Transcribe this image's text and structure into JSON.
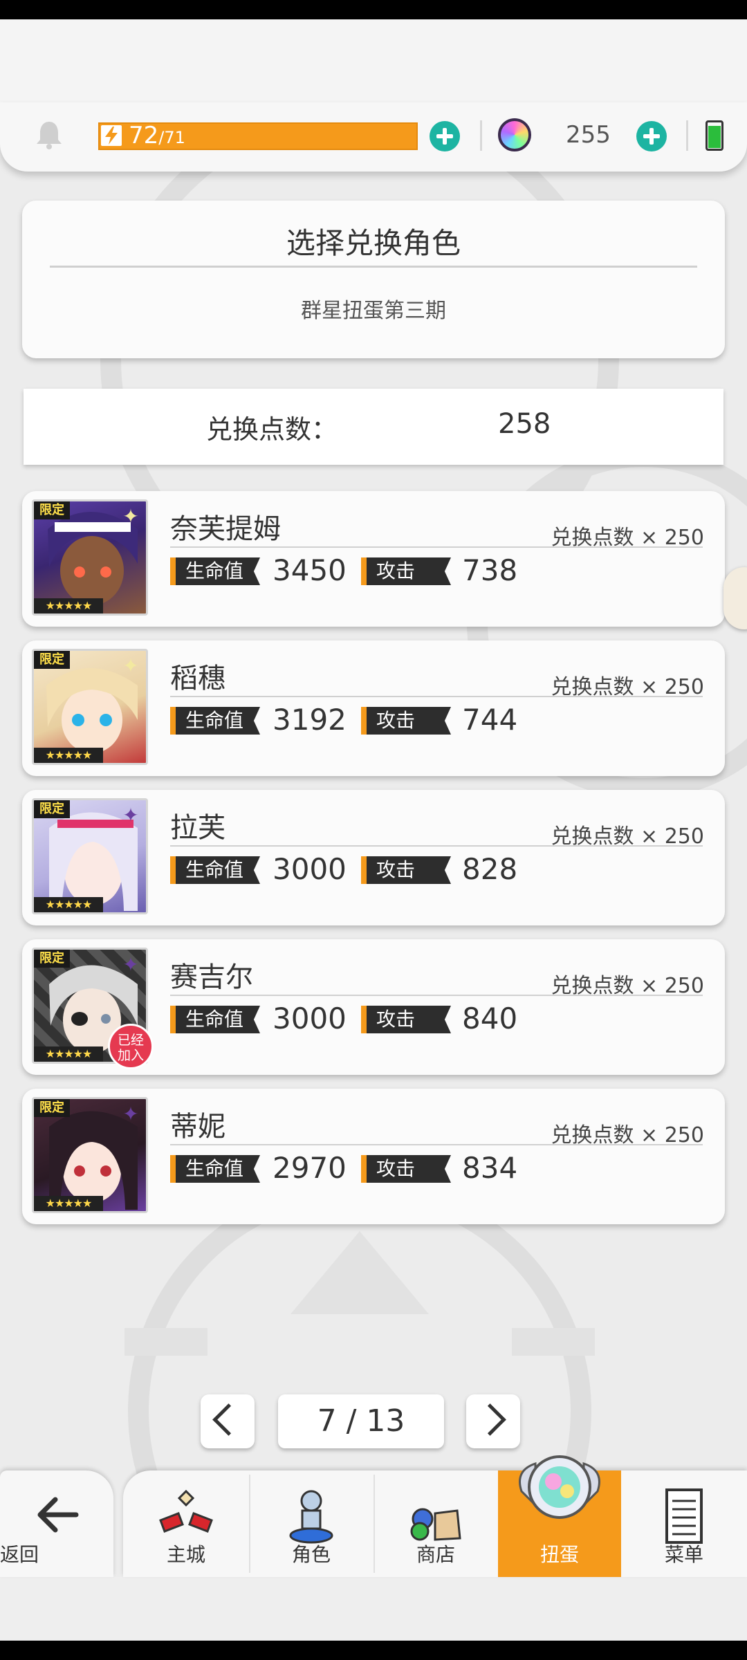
{
  "status": {
    "energy_current": "72",
    "energy_max": "/71",
    "gems": "255"
  },
  "header": {
    "title": "选择兑换角色",
    "subtitle": "群星扭蛋第三期"
  },
  "points": {
    "label": "兑换点数：",
    "value": "258"
  },
  "characters": [
    {
      "name": "奈芙提姆",
      "cost": "兑换点数 × 250",
      "hp_label": "生命值",
      "hp": "3450",
      "atk_label": "攻击",
      "atk": "738",
      "limited": "限定",
      "stars": "★★★★★",
      "element": "light"
    },
    {
      "name": "稻穗",
      "cost": "兑换点数 × 250",
      "hp_label": "生命值",
      "hp": "3192",
      "atk_label": "攻击",
      "atk": "744",
      "limited": "限定",
      "stars": "★★★★★",
      "element": "light"
    },
    {
      "name": "拉芙",
      "cost": "兑换点数 × 250",
      "hp_label": "生命值",
      "hp": "3000",
      "atk_label": "攻击",
      "atk": "828",
      "limited": "限定",
      "stars": "★★★★★",
      "element": "dark"
    },
    {
      "name": "赛吉尔",
      "cost": "兑换点数 × 250",
      "hp_label": "生命值",
      "hp": "3000",
      "atk_label": "攻击",
      "atk": "840",
      "limited": "限定",
      "stars": "★★★★★",
      "element": "dark",
      "joined_line1": "已经",
      "joined_line2": "加入"
    },
    {
      "name": "蒂妮",
      "cost": "兑换点数 × 250",
      "hp_label": "生命值",
      "hp": "2970",
      "atk_label": "攻击",
      "atk": "834",
      "limited": "限定",
      "stars": "★★★★★",
      "element": "dark"
    }
  ],
  "pager": {
    "text": "7 / 13"
  },
  "nav": {
    "back": "返回",
    "items": [
      "主城",
      "角色",
      "商店",
      "扭蛋",
      "菜单"
    ],
    "active": "扭蛋"
  },
  "colors": {
    "accent": "#f59a1b",
    "plus": "#1db4a2",
    "badge": "#e53950"
  }
}
